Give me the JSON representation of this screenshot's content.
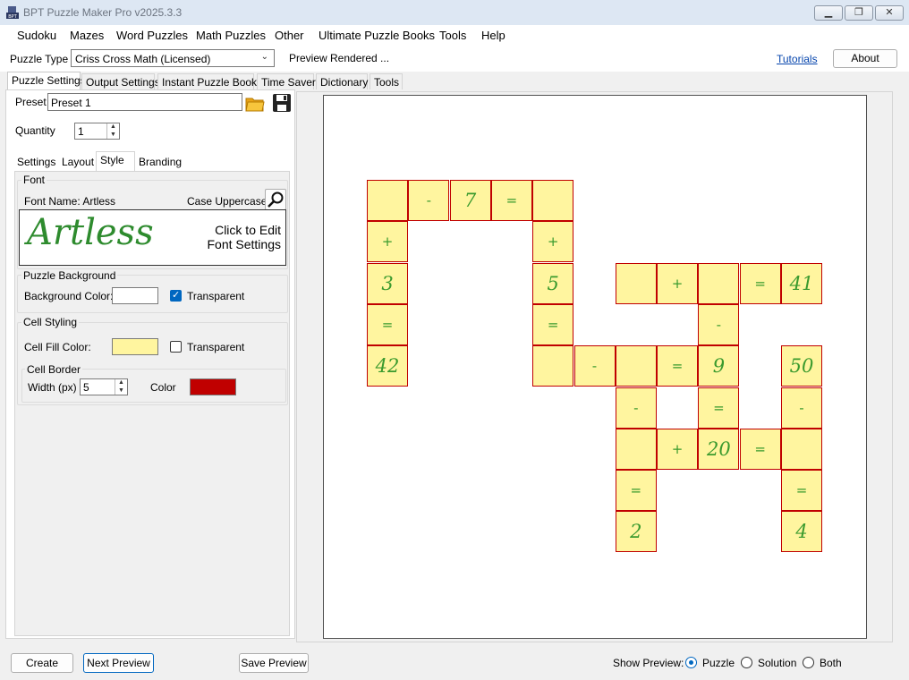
{
  "window": {
    "title": "BPT Puzzle Maker Pro v2025.3.3"
  },
  "menu": [
    "Sudoku",
    "Mazes",
    "Word Puzzles",
    "Math Puzzles",
    "Other",
    "Ultimate Puzzle Books",
    "Tools",
    "Help"
  ],
  "toolbar": {
    "puzzle_type_label": "Puzzle Type",
    "puzzle_type_value": "Criss Cross Math (Licensed)",
    "status": "Preview Rendered ...",
    "tutorials": "Tutorials",
    "about": "About"
  },
  "tabs": [
    "Puzzle Settings",
    "Output Settings",
    "Instant Puzzle Books",
    "Time Saver",
    "Dictionary",
    "Tools"
  ],
  "settings": {
    "preset_label": "Preset",
    "preset_value": "Preset 1",
    "quantity_label": "Quantity",
    "quantity_value": "1",
    "subtabs": [
      "Settings",
      "Layout",
      "Style",
      "Branding"
    ],
    "font_group": "Font",
    "font_name": "Font Name: Artless",
    "case_label": "Case Uppercase",
    "font_preview": "Artless",
    "font_click_line1": "Click to Edit",
    "font_click_line2": "Font Settings",
    "bg_group": "Puzzle Background",
    "bg_color_label": "Background Color:",
    "bg_transparent": "Transparent",
    "cell_group": "Cell Styling",
    "cell_fill_label": "Cell Fill Color:",
    "cell_transparent": "Transparent",
    "border_group": "Cell Border",
    "width_label": "Width (px)",
    "width_value": "5",
    "color_label": "Color"
  },
  "colors": {
    "cell_fill": "#fff59f",
    "cell_border": "#c00000",
    "background": "#ffffff",
    "glyph": "#3a9a2e",
    "accent": "#0067c0"
  },
  "puzzle": {
    "cells": [
      {
        "r": 0,
        "c": 0,
        "t": ""
      },
      {
        "r": 0,
        "c": 1,
        "t": "-"
      },
      {
        "r": 0,
        "c": 2,
        "t": "7"
      },
      {
        "r": 0,
        "c": 3,
        "t": "="
      },
      {
        "r": 0,
        "c": 4,
        "t": ""
      },
      {
        "r": 1,
        "c": 0,
        "t": "+"
      },
      {
        "r": 1,
        "c": 4,
        "t": "+"
      },
      {
        "r": 2,
        "c": 0,
        "t": "3"
      },
      {
        "r": 2,
        "c": 4,
        "t": "5"
      },
      {
        "r": 2,
        "c": 6,
        "t": ""
      },
      {
        "r": 2,
        "c": 7,
        "t": "+"
      },
      {
        "r": 2,
        "c": 8,
        "t": ""
      },
      {
        "r": 2,
        "c": 9,
        "t": "="
      },
      {
        "r": 2,
        "c": 10,
        "t": "41"
      },
      {
        "r": 3,
        "c": 0,
        "t": "="
      },
      {
        "r": 3,
        "c": 4,
        "t": "="
      },
      {
        "r": 3,
        "c": 8,
        "t": "-"
      },
      {
        "r": 4,
        "c": 0,
        "t": "42"
      },
      {
        "r": 4,
        "c": 4,
        "t": ""
      },
      {
        "r": 4,
        "c": 5,
        "t": "-"
      },
      {
        "r": 4,
        "c": 6,
        "t": ""
      },
      {
        "r": 4,
        "c": 7,
        "t": "="
      },
      {
        "r": 4,
        "c": 8,
        "t": "9"
      },
      {
        "r": 4,
        "c": 10,
        "t": "50"
      },
      {
        "r": 5,
        "c": 6,
        "t": "-"
      },
      {
        "r": 5,
        "c": 8,
        "t": "="
      },
      {
        "r": 5,
        "c": 10,
        "t": "-"
      },
      {
        "r": 6,
        "c": 6,
        "t": ""
      },
      {
        "r": 6,
        "c": 7,
        "t": "+"
      },
      {
        "r": 6,
        "c": 8,
        "t": "20"
      },
      {
        "r": 6,
        "c": 9,
        "t": "="
      },
      {
        "r": 6,
        "c": 10,
        "t": ""
      },
      {
        "r": 7,
        "c": 6,
        "t": "="
      },
      {
        "r": 7,
        "c": 10,
        "t": "="
      },
      {
        "r": 8,
        "c": 6,
        "t": "2"
      },
      {
        "r": 8,
        "c": 10,
        "t": "4"
      }
    ]
  },
  "bottom": {
    "create": "Create",
    "next_preview": "Next Preview",
    "save_preview": "Save Preview",
    "show_preview_label": "Show Preview:",
    "options": [
      "Puzzle",
      "Solution",
      "Both"
    ],
    "selected": "Puzzle"
  }
}
